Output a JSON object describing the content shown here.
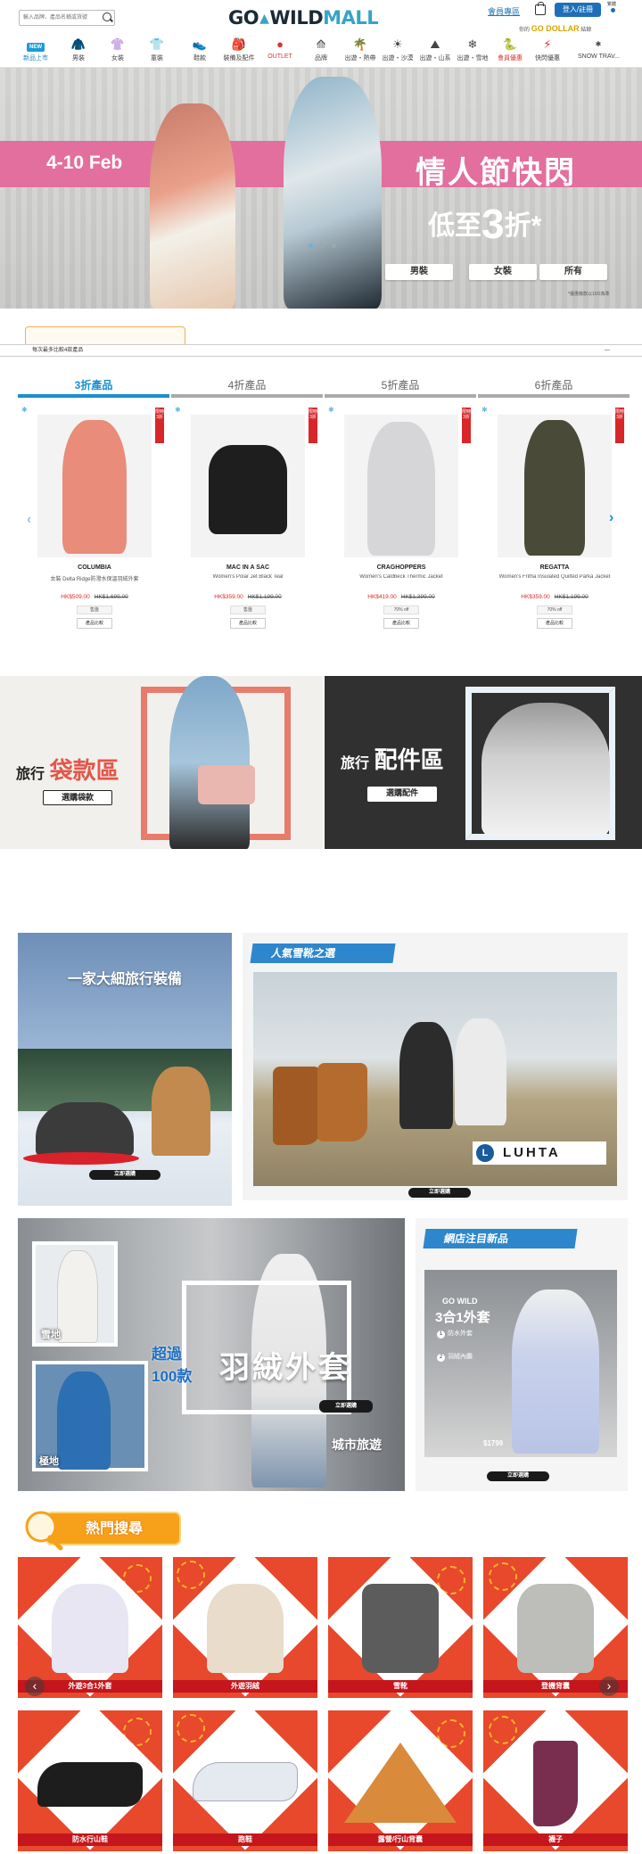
{
  "header": {
    "search_placeholder": "輸入品牌、產品名稱或貨號",
    "logo_go": "GO",
    "logo_wild": "WILD",
    "logo_mall": "MALL",
    "member_link": "會員專區",
    "login_label": "登入/註冊",
    "lang_label": "繁體",
    "godollar_prefix": "你的",
    "godollar_brand": "GO DOLLAR",
    "godollar_suffix": "結餘",
    "nav": [
      {
        "label": "新品上市",
        "icon": "new-tag"
      },
      {
        "label": "男裝",
        "icon": "jacket-icon"
      },
      {
        "label": "女裝",
        "icon": "dress-icon"
      },
      {
        "label": "童裝",
        "icon": "tshirt-icon"
      },
      {
        "label": "鞋款",
        "icon": "shoe-icon"
      },
      {
        "label": "裝備及配件",
        "icon": "backpack-icon"
      },
      {
        "label": "OUTLET",
        "icon": "sale-icon"
      },
      {
        "label": "品牌",
        "icon": "logo-icon"
      },
      {
        "label": "出遊・熱帶",
        "icon": "palm-icon"
      },
      {
        "label": "出遊・沙漠",
        "icon": "desert-icon"
      },
      {
        "label": "出遊・山系",
        "icon": "mountain-icon"
      },
      {
        "label": "出遊・雪地",
        "icon": "snow-icon"
      },
      {
        "label": "會員優惠",
        "icon": "snake-icon"
      },
      {
        "label": "快閃優惠",
        "icon": "flash-icon"
      },
      {
        "label": "SNOW TRAV...",
        "icon": "snowtravel-icon"
      }
    ]
  },
  "hero": {
    "date": "4-10 Feb",
    "title": "情人節快閃",
    "sub_prefix": "低至",
    "sub_num": "3",
    "sub_suffix": "折*",
    "buttons": [
      "男裝",
      "女裝",
      "所有"
    ],
    "note": "*優惠條款以10/2為準",
    "colors": {
      "band": "#e36f9e"
    }
  },
  "notice": {
    "text": "每次最多比較4款產品",
    "dash": "—"
  },
  "tabs": [
    "3折產品",
    "4折產品",
    "5折產品",
    "6折產品"
  ],
  "products": [
    {
      "brand": "COLUMBIA",
      "name": "女裝 Delta Ridge防潑水保溫羽絨外套",
      "price": "HK$509.00",
      "was": "HK$1,699.00",
      "tag": "售盤",
      "compare": "產品比較",
      "badge": "限時3折",
      "color": "#e98c7a"
    },
    {
      "brand": "MAC IN A SAC",
      "name": "Women's Polar Jet Black Teal",
      "price": "HK$359.00",
      "was": "HK$1,199.00",
      "tag": "售盤",
      "compare": "產品比較",
      "badge": "限時3折",
      "color": "#1e1e1e"
    },
    {
      "brand": "CRAGHOPPERS",
      "name": "Women's Caldbeck Thermic Jacket",
      "price": "HK$419.00",
      "was": "HK$1,399.00",
      "tag": "70% off",
      "compare": "產品比較",
      "badge": "限時3折",
      "color": "#d6d6d8"
    },
    {
      "brand": "REGATTA",
      "name": "Women's Fritha Insulated Quilted Parka Jacket",
      "price": "HK$359.00",
      "was": "HK$1,199.00",
      "tag": "70% off",
      "compare": "產品比較",
      "badge": "限時3折",
      "color": "#4a4a38"
    }
  ],
  "travel": {
    "bag_prefix": "旅行",
    "bag_main": "袋款區",
    "bag_btn": "選購袋款",
    "acc_prefix": "旅行",
    "acc_main": "配件區",
    "acc_btn": "選購配件",
    "colors": {
      "bag_frame": "#e77b6c",
      "acc_frame": "#e9f2fa"
    }
  },
  "panels": {
    "family_title": "一家大細旅行裝備",
    "family_btn": "立即選購",
    "boots_ribbon": "人氣雪靴之選",
    "boots_brand": "LUHTA",
    "boots_btn": "立即選購",
    "down_count_prefix": "超過",
    "down_count": "100款",
    "down_title": "羽絨外套",
    "down_btn": "立即選購",
    "down_city": "城市旅遊",
    "down_snow": "雪地",
    "down_cold": "極地",
    "new_ribbon": "網店注目新品",
    "new_brand": "GO WILD",
    "new_title": "3合1外套",
    "new_item1": "防水外套",
    "new_item2": "羽絨內膽",
    "new_price": "$1799",
    "new_btn": "立即選購"
  },
  "hot": {
    "title": "熱門搜尋",
    "tiles": [
      "外遊3合1外套",
      "外遊羽絨",
      "雪靴",
      "登機背囊",
      "防水行山鞋",
      "跑鞋",
      "露營/行山背囊",
      "襪子"
    ],
    "tile_colors": [
      "#e8e6f2",
      "#e9dccb",
      "#5c5c5c",
      "#bdbdb9",
      "#1d1d1d",
      "#e5e9f0",
      "#d98a3b",
      "#7a2e4f"
    ]
  }
}
